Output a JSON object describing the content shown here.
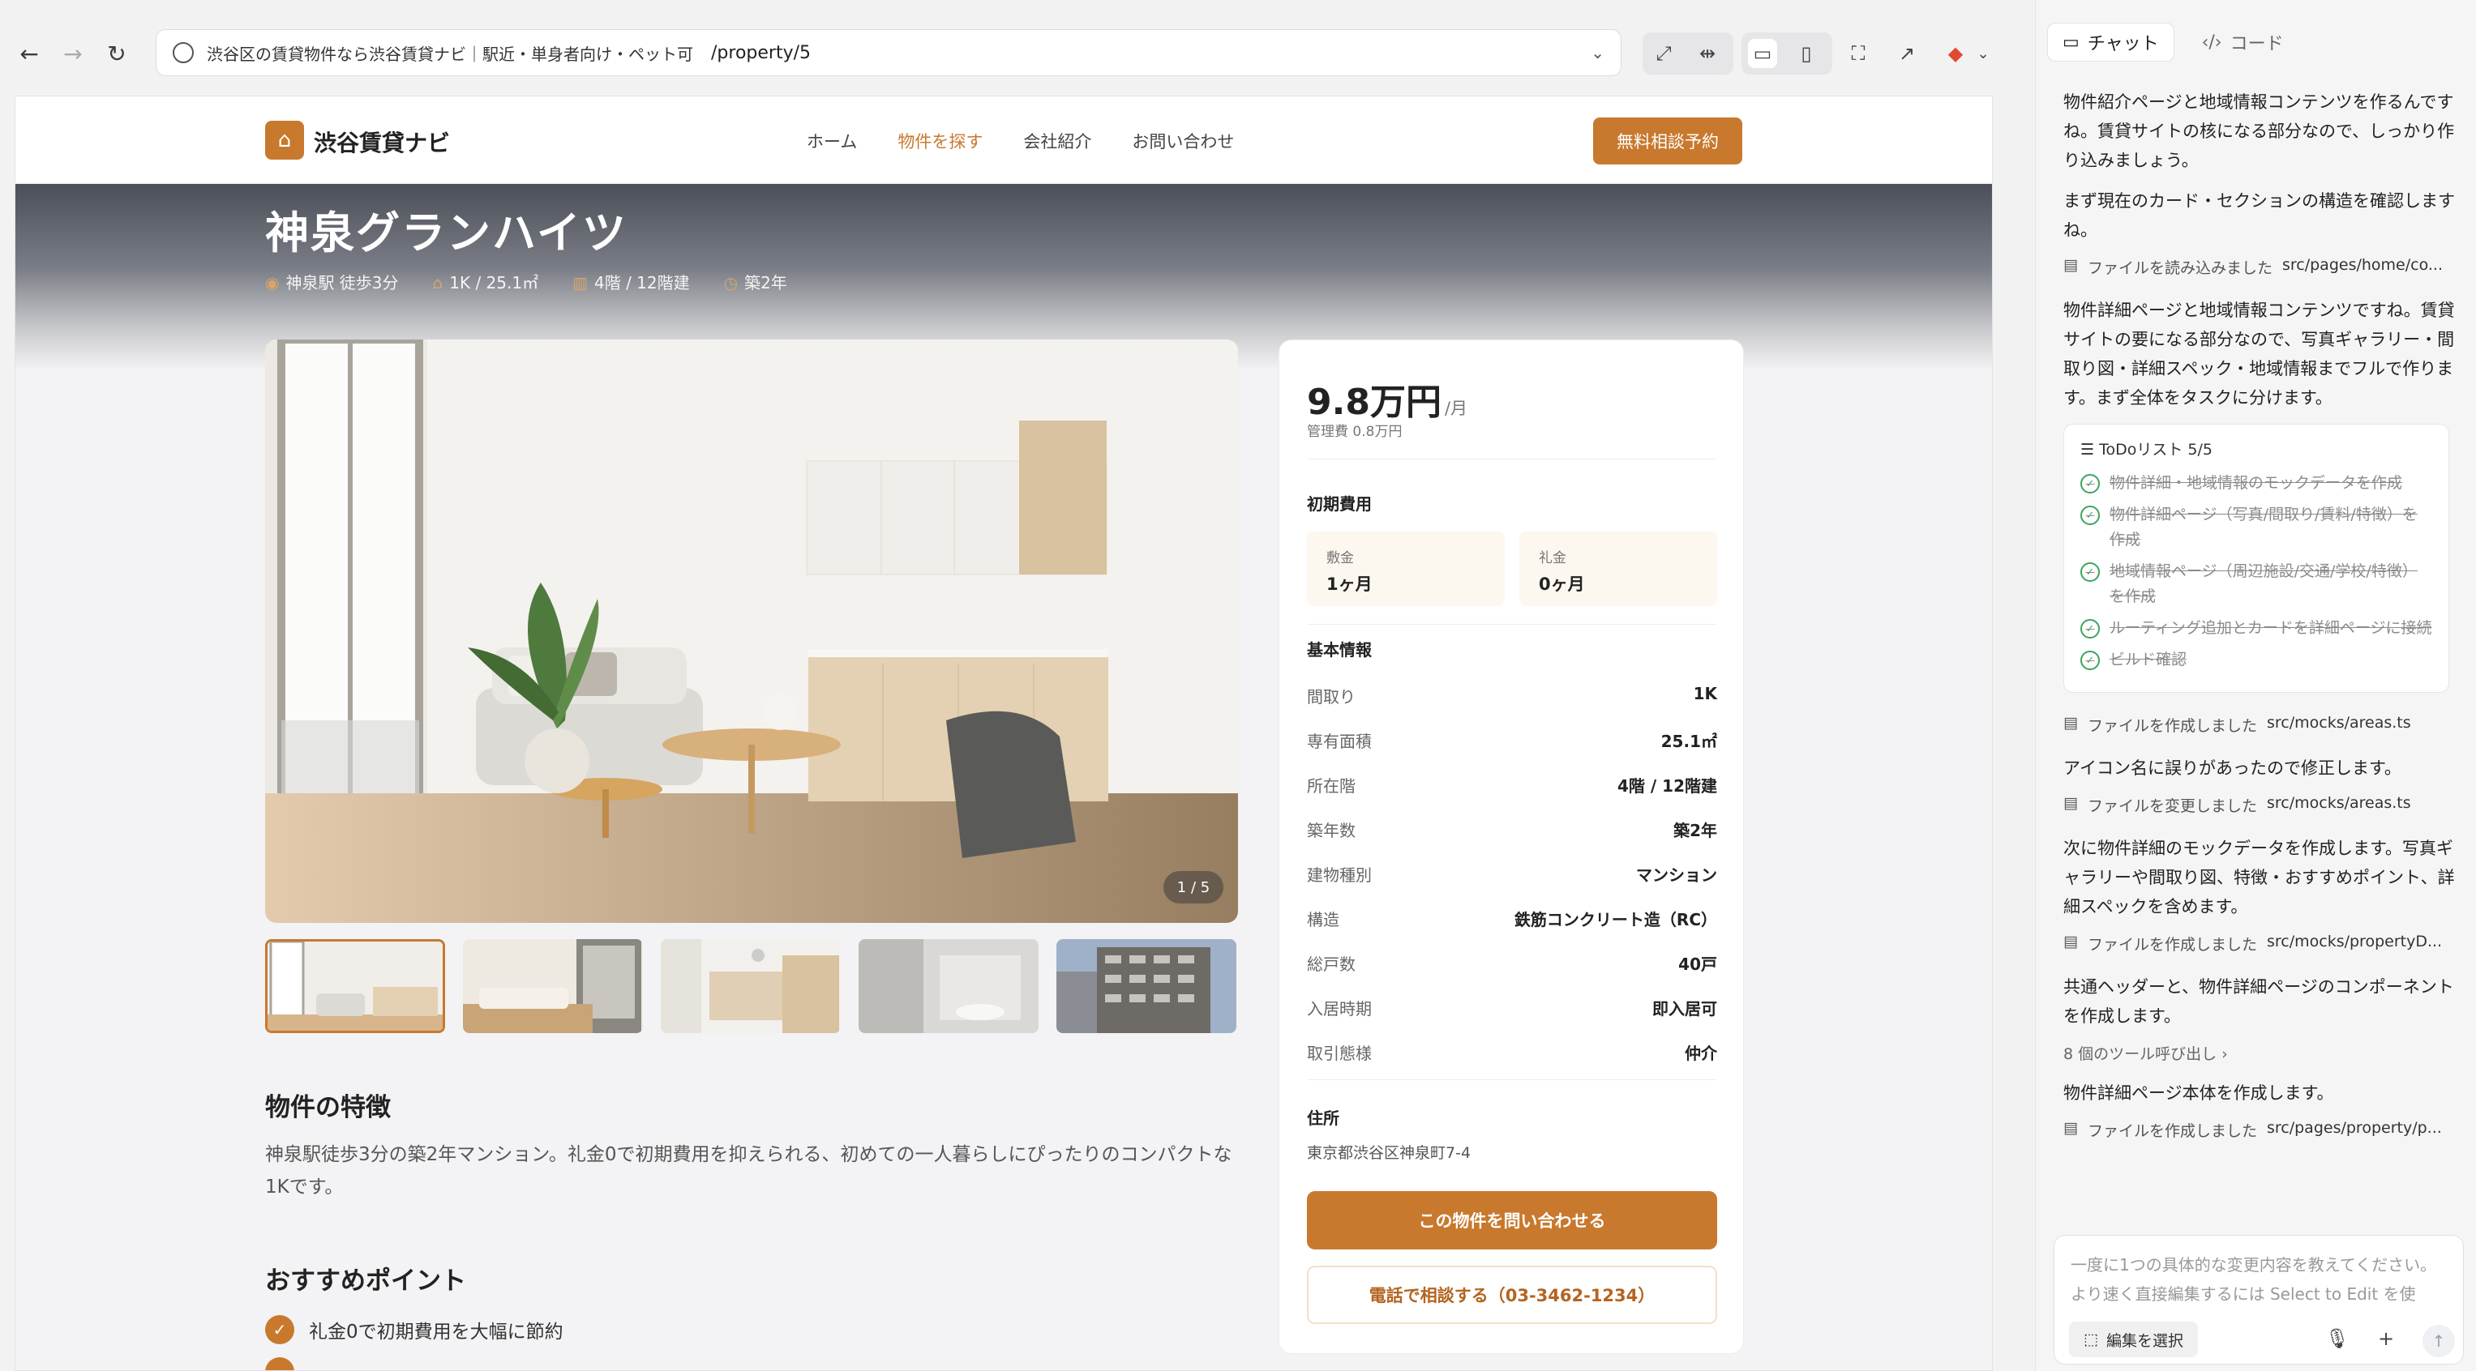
{
  "browser": {
    "page_title": "渋谷区の賃貸物件なら渋谷賃貸ナビ｜駅近・単身者向け・ペット可",
    "path": "/property/5"
  },
  "site": {
    "brand": "渋谷賃貸ナビ",
    "nav": [
      "ホーム",
      "物件を探す",
      "会社紹介",
      "お問い合わせ"
    ],
    "active_nav": "物件を探す",
    "cta": "無料相談予約"
  },
  "property": {
    "name": "神泉グランハイツ",
    "meta": {
      "station": "神泉駅 徒歩3分",
      "layout": "1K / 25.1㎡",
      "floor": "4階 / 12階建",
      "age": "築2年"
    },
    "photo_counter": "1 / 5",
    "features_title": "物件の特徴",
    "features_desc": "神泉駅徒歩3分の築2年マンション。礼金0で初期費用を抑えられる、初めての一人暮らしにぴったりのコンパクトな1Kです。",
    "recommend_title": "おすすめポイント",
    "recommend_items": [
      "礼金0で初期費用を大幅に節約"
    ]
  },
  "card": {
    "price": "9.8万円",
    "price_unit": "/月",
    "management": "管理費 0.8万円",
    "initial_cost_label": "初期費用",
    "deposit": {
      "k": "敷金",
      "v": "1ヶ月"
    },
    "key_money": {
      "k": "礼金",
      "v": "0ヶ月"
    },
    "basic_info_label": "基本情報",
    "specs": [
      {
        "k": "間取り",
        "v": "1K"
      },
      {
        "k": "専有面積",
        "v": "25.1㎡"
      },
      {
        "k": "所在階",
        "v": "4階 / 12階建"
      },
      {
        "k": "築年数",
        "v": "築2年"
      },
      {
        "k": "建物種別",
        "v": "マンション"
      },
      {
        "k": "構造",
        "v": "鉄筋コンクリート造（RC）"
      },
      {
        "k": "総戸数",
        "v": "40戸"
      },
      {
        "k": "入居時期",
        "v": "即入居可"
      },
      {
        "k": "取引態様",
        "v": "仲介"
      }
    ],
    "address_label": "住所",
    "address": "東京都渋谷区神泉町7-4",
    "inquire_button": "この物件を問い合わせる",
    "phone_button": "電話で相談する（03-3462-1234）"
  },
  "panel": {
    "tab_chat": "チャット",
    "tab_code": "コード",
    "msg1": "物件紹介ページと地域情報コンテンツを作るんですね。賃貸サイトの核になる部分なので、しっかり作り込みましょう。",
    "msg2": "まず現在のカード・セクションの構造を確認しますね。",
    "file1": {
      "action": "ファイルを読み込みました",
      "path": "src/pages/home/co..."
    },
    "msg3": "物件詳細ページと地域情報コンテンツですね。賃貸サイトの要になる部分なので、写真ギャラリー・間取り図・詳細スペック・地域情報までフルで作ります。まず全体をタスクに分けます。",
    "todo_title": "ToDoリスト  5/5",
    "todos": [
      "物件詳細・地域情報のモックデータを作成",
      "物件詳細ページ（写真/間取り/賃料/特徴）を作成",
      "地域情報ページ（周辺施設/交通/学校/特徴）を作成",
      "ルーティング追加とカードを詳細ページに接続",
      "ビルド確認"
    ],
    "file2": {
      "action": "ファイルを作成しました",
      "path": "src/mocks/areas.ts"
    },
    "msg4": "アイコン名に誤りがあったので修正します。",
    "file3": {
      "action": "ファイルを変更しました",
      "path": "src/mocks/areas.ts"
    },
    "msg5": "次に物件詳細のモックデータを作成します。写真ギャラリーや間取り図、特徴・おすすめポイント、詳細スペックを含めます。",
    "file4": {
      "action": "ファイルを作成しました",
      "path": "src/mocks/propertyD..."
    },
    "msg6": "共通ヘッダーと、物件詳細ページのコンポーネントを作成します。",
    "tools": "8 個のツール呼び出し  ›",
    "msg7": "物件詳細ページ本体を作成します。",
    "file5": {
      "action": "ファイルを作成しました",
      "path": "src/pages/property/p..."
    },
    "input_placeholder": "一度に1つの具体的な変更内容を教えてください。より速く直接編集するには Select to Edit を使",
    "select_edit": "編集を選択"
  },
  "colors": {
    "accent": "#c8792e",
    "success": "#3aa55b"
  }
}
